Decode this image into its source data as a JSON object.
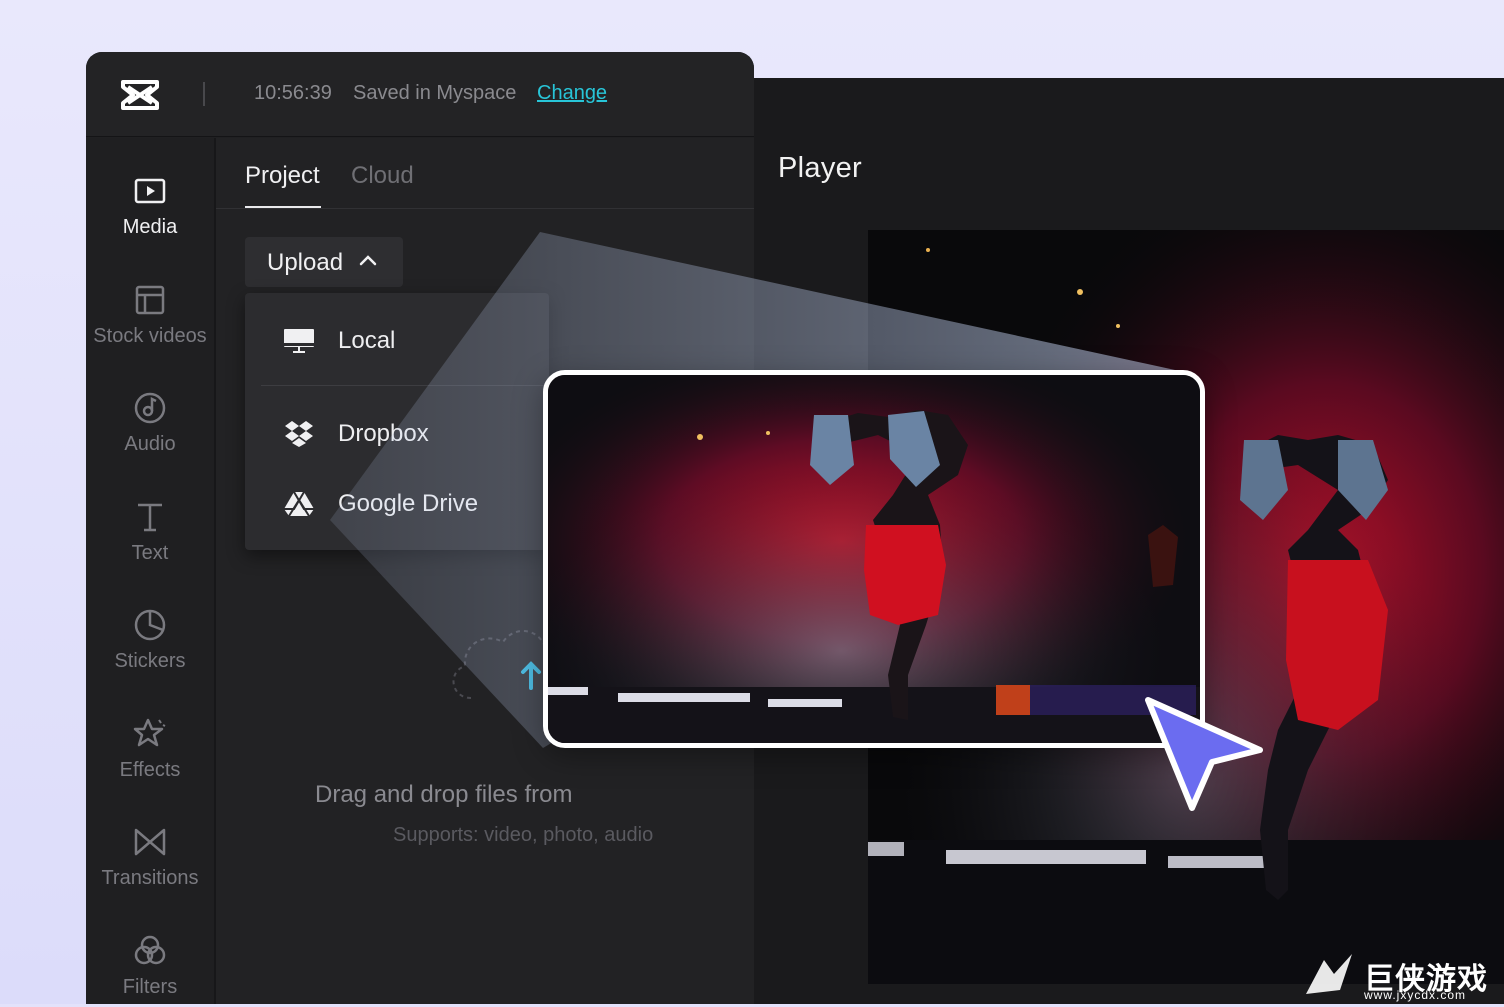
{
  "topbar": {
    "time": "10:56:39",
    "status": "Saved in Myspace",
    "change_link": "Change"
  },
  "rail": {
    "items": [
      {
        "label": "Media",
        "icon": "media-icon",
        "active": true
      },
      {
        "label": "Stock videos",
        "icon": "stock-videos-icon"
      },
      {
        "label": "Audio",
        "icon": "audio-icon"
      },
      {
        "label": "Text",
        "icon": "text-icon"
      },
      {
        "label": "Stickers",
        "icon": "stickers-icon"
      },
      {
        "label": "Effects",
        "icon": "effects-icon"
      },
      {
        "label": "Transitions",
        "icon": "transitions-icon"
      },
      {
        "label": "Filters",
        "icon": "filters-icon"
      }
    ]
  },
  "panel": {
    "tabs": [
      {
        "label": "Project",
        "active": true
      },
      {
        "label": "Cloud"
      }
    ],
    "upload": {
      "label": "Upload",
      "options": [
        {
          "label": "Local",
          "icon": "monitor-icon"
        },
        {
          "label": "Dropbox",
          "icon": "dropbox-icon"
        },
        {
          "label": "Google Drive",
          "icon": "google-drive-icon"
        }
      ]
    },
    "dropzone": {
      "title": "Drag and drop files from",
      "subtitle": "Supports: video, photo, audio"
    }
  },
  "player": {
    "title": "Player"
  },
  "watermark": {
    "text": "巨侠游戏",
    "url": "www.jxycdx.com"
  },
  "colors": {
    "accent_link": "#28c5d8",
    "cursor": "#6b6cf0",
    "upload_arrow": "#2bb8e0"
  }
}
